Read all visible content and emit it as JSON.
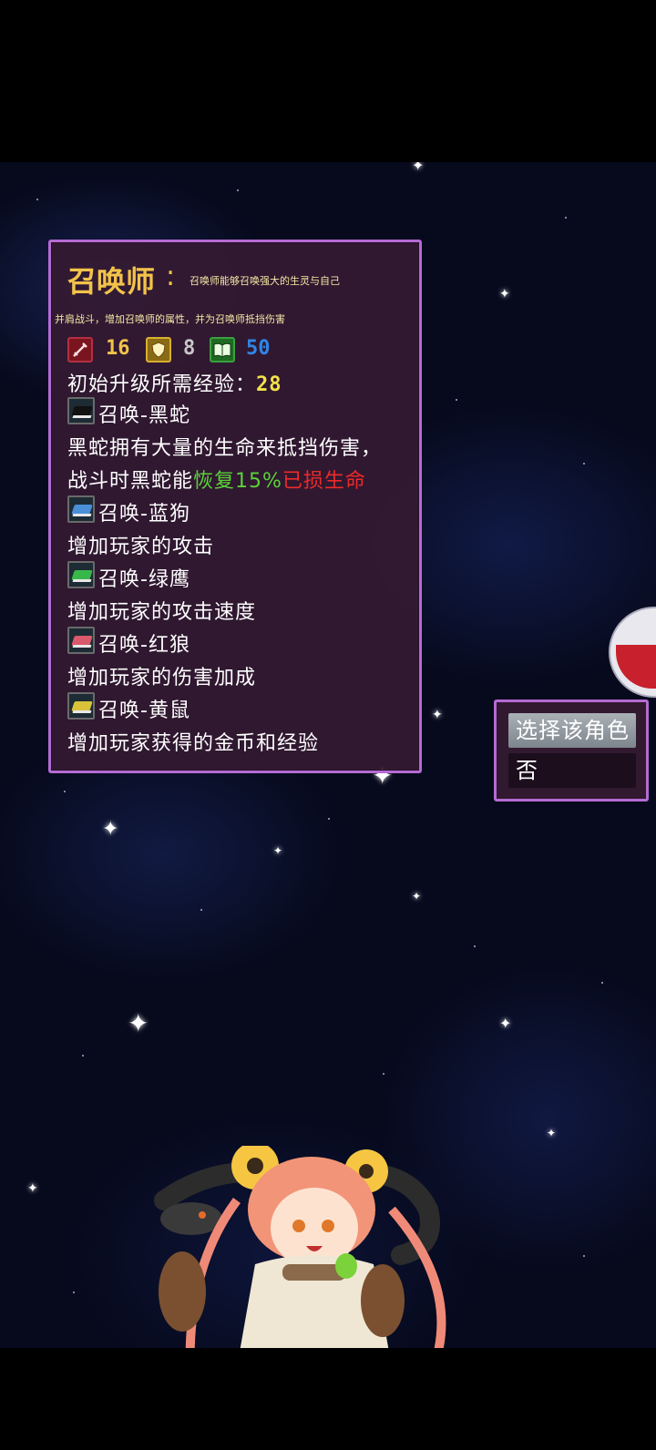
{
  "class_info": {
    "title": "召唤师",
    "colon": ":",
    "description_line1": "召唤师能够召唤强大的生灵与自己",
    "description_line2": "并肩战斗，增加召唤师的属性，并为召唤师抵挡伤害",
    "stats": [
      {
        "icon": "sword-icon",
        "value": "16",
        "color": "#f2c34a"
      },
      {
        "icon": "shield-icon",
        "value": "8",
        "color": "#c8c8c8"
      },
      {
        "icon": "spellbook-icon",
        "value": "50",
        "color": "#2f86e6"
      }
    ],
    "exp_label": "初始升级所需经验：",
    "exp_value": "28"
  },
  "summons": [
    {
      "name": "召唤-黑蛇",
      "book_color": "#111111",
      "desc": "黑蛇拥有大量的生命来抵挡伤害，",
      "desc2_prefix": "战斗时黑蛇能",
      "desc2_green": "恢复15%",
      "desc2_red": "已损生命"
    },
    {
      "name": "召唤-蓝狗",
      "book_color": "#4a8fd8",
      "desc": "增加玩家的攻击"
    },
    {
      "name": "召唤-绿鹰",
      "book_color": "#39b84a",
      "desc": "增加玩家的攻击速度"
    },
    {
      "name": "召唤-红狼",
      "book_color": "#d95a6a",
      "desc": "增加玩家的伤害加成"
    },
    {
      "name": "召唤-黄鼠",
      "book_color": "#d9c23a",
      "desc": "增加玩家获得的金币和经验"
    }
  ],
  "colors": {
    "green": "#5ad13a",
    "red": "#ee2a2a",
    "gold": "#f2c34a",
    "panel_border": "#b46bd3"
  },
  "choice": {
    "yes": "选择该角色",
    "no": "否"
  }
}
